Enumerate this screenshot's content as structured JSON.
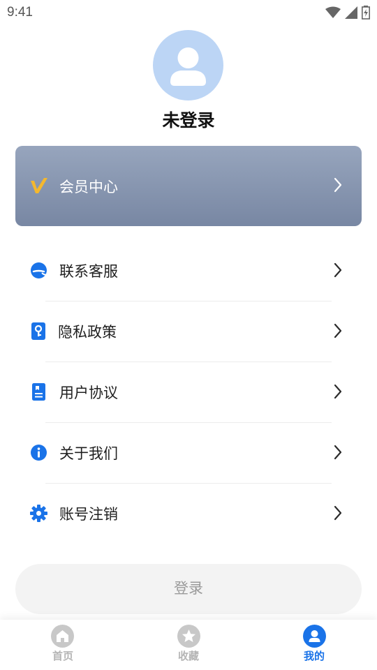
{
  "status_bar": {
    "time": "9:41"
  },
  "profile": {
    "username": "未登录"
  },
  "vip": {
    "label": "会员中心"
  },
  "menu": {
    "items": [
      {
        "label": "联系客服",
        "icon": "customer-service-icon"
      },
      {
        "label": "隐私政策",
        "icon": "privacy-key-icon"
      },
      {
        "label": "用户协议",
        "icon": "document-icon"
      },
      {
        "label": "关于我们",
        "icon": "info-icon"
      },
      {
        "label": "账号注销",
        "icon": "gear-icon"
      }
    ]
  },
  "login_button": {
    "label": "登录"
  },
  "tab_bar": {
    "tabs": [
      {
        "label": "首页",
        "icon": "home-icon",
        "active": false
      },
      {
        "label": "收藏",
        "icon": "star-icon",
        "active": false
      },
      {
        "label": "我的",
        "icon": "user-icon",
        "active": true
      }
    ]
  },
  "colors": {
    "accent": "#1a73e8",
    "vip_gold": "#f5b82e",
    "avatar_bg": "#bcd5f5",
    "tab_inactive": "#c8c8c8"
  }
}
